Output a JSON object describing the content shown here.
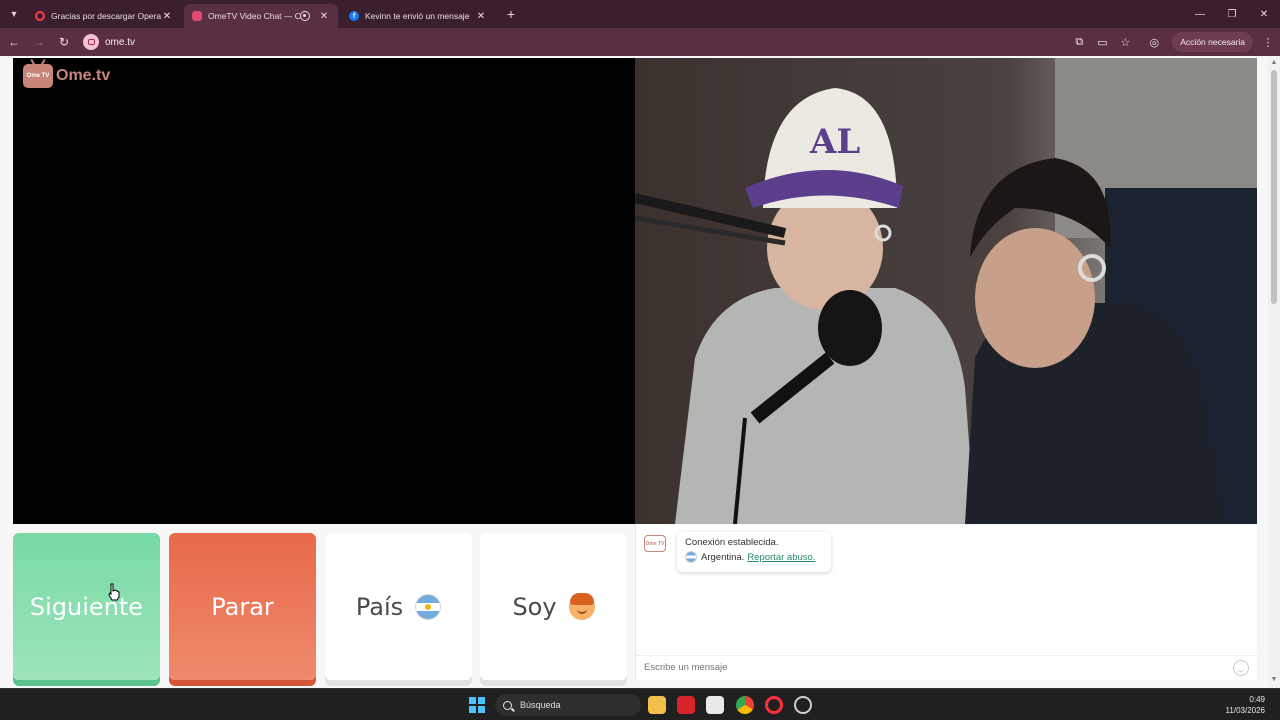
{
  "browser": {
    "tabs": [
      {
        "title": "Gracias por descargar Opera",
        "active": false,
        "favicon": "opera-icon"
      },
      {
        "title": "OmeTV Video Chat — Ome",
        "active": true,
        "favicon": "ometv-icon"
      },
      {
        "title": "Kevinn te envió un mensaje",
        "active": false,
        "favicon": "facebook-icon"
      }
    ],
    "url": "ome.tv",
    "action_label": "Acción necesaria"
  },
  "page": {
    "logo_text": "Ome.tv",
    "logo_badge": "Ome TV",
    "buttons": {
      "next": "Siguiente",
      "stop": "Parar",
      "country": "País",
      "gender": "Soy"
    },
    "chat": {
      "connection_text": "Conexión establecida.",
      "country_text": "Argentina.",
      "report_link": "Reportar abuso.",
      "message_placeholder": "Escribe un mensaje"
    }
  },
  "taskbar": {
    "search_label": "Búsqueda",
    "time": "0:49",
    "date": "11/03/2026"
  },
  "colors": {
    "next": "#78d9a5",
    "stop": "#e8694c",
    "brand": "#c8857a",
    "tabbar": "#3c1f2e",
    "toolbar": "#5a2f43"
  }
}
